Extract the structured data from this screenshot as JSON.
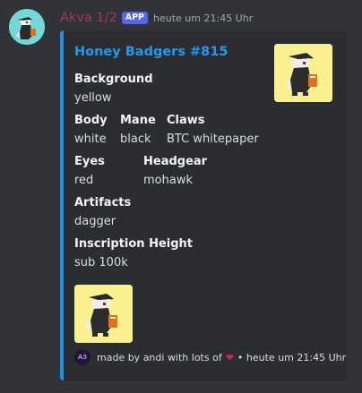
{
  "message": {
    "username": "Akva 1/2",
    "badge": "APP",
    "timestamp": "heute um 21:45 Uhr"
  },
  "embed": {
    "accent_color": "#1f8feb",
    "title": "Honey Badgers #815",
    "fields": {
      "background": {
        "name": "Background",
        "value": "yellow"
      },
      "body": {
        "name": "Body",
        "value": "white"
      },
      "mane": {
        "name": "Mane",
        "value": "black"
      },
      "claws": {
        "name": "Claws",
        "value": "BTC whitepaper"
      },
      "eyes": {
        "name": "Eyes",
        "value": "red"
      },
      "headgear": {
        "name": "Headgear",
        "value": "mohawk"
      },
      "artifacts": {
        "name": "Artifacts",
        "value": "dagger"
      },
      "inscription_height": {
        "name": "Inscription Height",
        "value": "sub 100k"
      }
    },
    "footer": {
      "text_before": "made by andi with lots of",
      "text_after": "• heute um 21:45 Uhr",
      "icon_label": "A3"
    }
  },
  "icons": {
    "avatar": "honey-badger-icon",
    "thumbnail": "honey-badger-icon",
    "heart": "heart-icon"
  }
}
